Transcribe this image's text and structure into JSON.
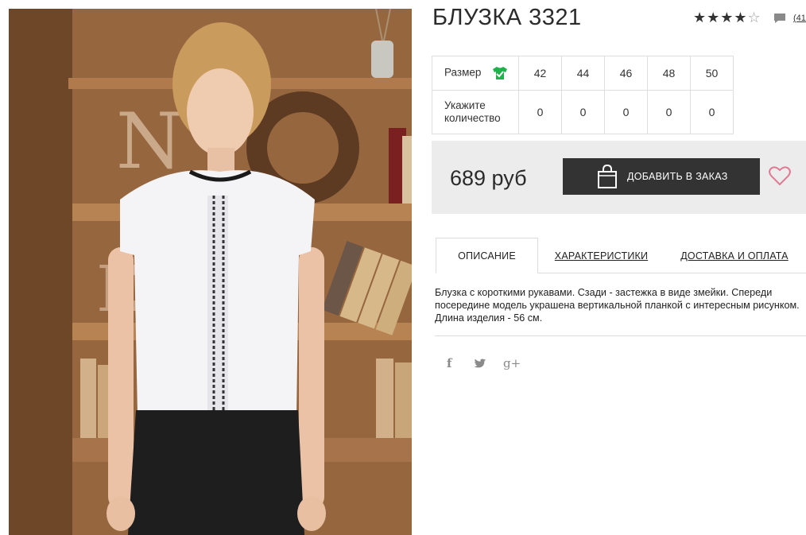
{
  "product": {
    "title": "БЛУЗКА 3321",
    "rating_filled": "★★★★",
    "rating_empty": "☆",
    "rating_value": 4,
    "rating_max": 5,
    "comments_label": "(41"
  },
  "sizes": {
    "size_label": "Размер",
    "qty_label_line1": "Укажите",
    "qty_label_line2": "количество",
    "values": [
      "42",
      "44",
      "46",
      "48",
      "50"
    ],
    "quantities": [
      "0",
      "0",
      "0",
      "0",
      "0"
    ]
  },
  "buy": {
    "price": "689 руб",
    "order_label": "ДОБАВИТЬ В ЗАКАЗ"
  },
  "tabs": {
    "description": "ОПИСАНИЕ",
    "characteristics": "ХАРАКТЕРИСТИКИ",
    "delivery": "ДОСТАВКА И ОПЛАТА"
  },
  "description": "Блузка с короткими рукавами. Сзади - застежка в виде змейки. Спереди посередине модель украшена вертикальной планкой с интересным рисунком. Длина изделия - 56 см.",
  "social": {
    "facebook": "f",
    "twitter": "🐦",
    "googleplus": "g+"
  },
  "colors": {
    "accent_green": "#1fb14a",
    "heart_pink": "#e07a93",
    "button_dark": "#333333",
    "buybox_bg": "#ececec"
  },
  "icons": [
    "star-icon",
    "comment-icon",
    "shirt-icon",
    "bag-icon",
    "heart-icon",
    "facebook-icon",
    "twitter-icon",
    "google-plus-icon"
  ]
}
